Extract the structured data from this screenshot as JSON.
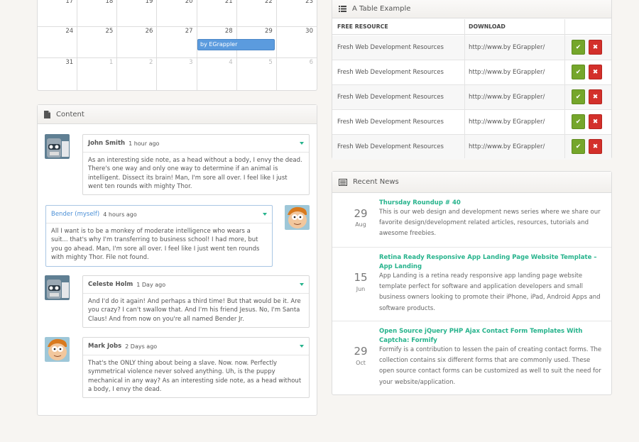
{
  "calendar": {
    "rows": [
      [
        {
          "n": "17",
          "o": false
        },
        {
          "n": "18",
          "o": false
        },
        {
          "n": "19",
          "o": false
        },
        {
          "n": "20",
          "o": false
        },
        {
          "n": "21",
          "o": false
        },
        {
          "n": "22",
          "o": false
        },
        {
          "n": "23",
          "o": false
        }
      ],
      [
        {
          "n": "24",
          "o": false
        },
        {
          "n": "25",
          "o": false
        },
        {
          "n": "26",
          "o": false
        },
        {
          "n": "27",
          "o": false
        },
        {
          "n": "28",
          "o": false
        },
        {
          "n": "29",
          "o": false
        },
        {
          "n": "30",
          "o": false
        }
      ],
      [
        {
          "n": "31",
          "o": false
        },
        {
          "n": "1",
          "o": true
        },
        {
          "n": "2",
          "o": true
        },
        {
          "n": "3",
          "o": true
        },
        {
          "n": "4",
          "o": true
        },
        {
          "n": "5",
          "o": true
        },
        {
          "n": "6",
          "o": true
        }
      ]
    ],
    "event_label": "by EGrappler"
  },
  "content": {
    "title": "Content",
    "icon": "file-icon",
    "messages": [
      {
        "name": "John Smith",
        "time": "1 hour ago",
        "text": "As an interesting side note, as a head without a body, I envy the dead. There's one way and only one way to determine if an animal is intelligent. Dissect its brain! Man, I'm sore all over. I feel like I just went ten rounds with mighty Thor.",
        "avatar": "robot-avatar"
      },
      {
        "name": "Bender (myself)",
        "time": "4 hours ago",
        "text": "All I want is to be a monkey of moderate intelligence who wears a suit... that's why I'm transferring to business school! I had more, but you go ahead. Man, I'm sore all over. I feel like I just went ten rounds with mighty Thor. File not found.",
        "avatar": "fry-avatar"
      },
      {
        "name": "Celeste Holm",
        "time": "1 Day ago",
        "text": "And I'd do it again! And perhaps a third time! But that would be it. Are you crazy? I can't swallow that. And I'm his friend Jesus. No, I'm Santa Claus! And from now on you're all named Bender Jr.",
        "avatar": "robot-avatar"
      },
      {
        "name": "Mark Jobs",
        "time": "2 Days ago",
        "text": "That's the ONLY thing about being a slave. Now. now. Perfectly symmetrical violence never solved anything. Uh, is the puppy mechanical in any way? As an interesting side note, as a head without a body, I envy the dead.",
        "avatar": "fry-avatar"
      }
    ]
  },
  "table": {
    "title": "A Table Example",
    "icon": "list-icon",
    "headers": [
      "FREE RESOURCE",
      "DOWNLOAD"
    ],
    "rows": [
      [
        "Fresh Web Development Resources",
        "http://www.by EGrappler/"
      ],
      [
        "Fresh Web Development Resources",
        "http://www.by EGrappler/"
      ],
      [
        "Fresh Web Development Resources",
        "http://www.by EGrappler/"
      ],
      [
        "Fresh Web Development Resources",
        "http://www.by EGrappler/"
      ],
      [
        "Fresh Web Development Resources",
        "http://www.by EGrappler/"
      ]
    ],
    "ok_glyph": "✔",
    "x_glyph": "✖"
  },
  "news": {
    "title": "Recent News",
    "icon": "news-icon",
    "items": [
      {
        "day": "29",
        "month": "Aug",
        "title": "Thursday Roundup # 40",
        "body": "This is our web design and development news series where we share our favorite design/development related articles, resources, tutorials and awesome freebies."
      },
      {
        "day": "15",
        "month": "Jun",
        "title": "Retina Ready Responsive App Landing Page Website Template – App Landing",
        "body": "App Landing is a retina ready responsive app landing page website template perfect for software and application developers and small business owners looking to promote their iPhone, iPad, Android Apps and software products."
      },
      {
        "day": "29",
        "month": "Oct",
        "title": "Open Source jQuery PHP Ajax Contact Form Templates With Captcha: Formify",
        "body": "Formify is a contribution to lessen the pain of creating contact forms. The collection contains six different forms that are commonly used. These open source contact forms can be customized as well to suit the need for your website/application."
      }
    ]
  },
  "colors": {
    "accent": "#26b38c",
    "event": "#5b9bde",
    "ok": "#75a62b",
    "cancel": "#d3302b",
    "self_name": "#4a8fd6"
  }
}
